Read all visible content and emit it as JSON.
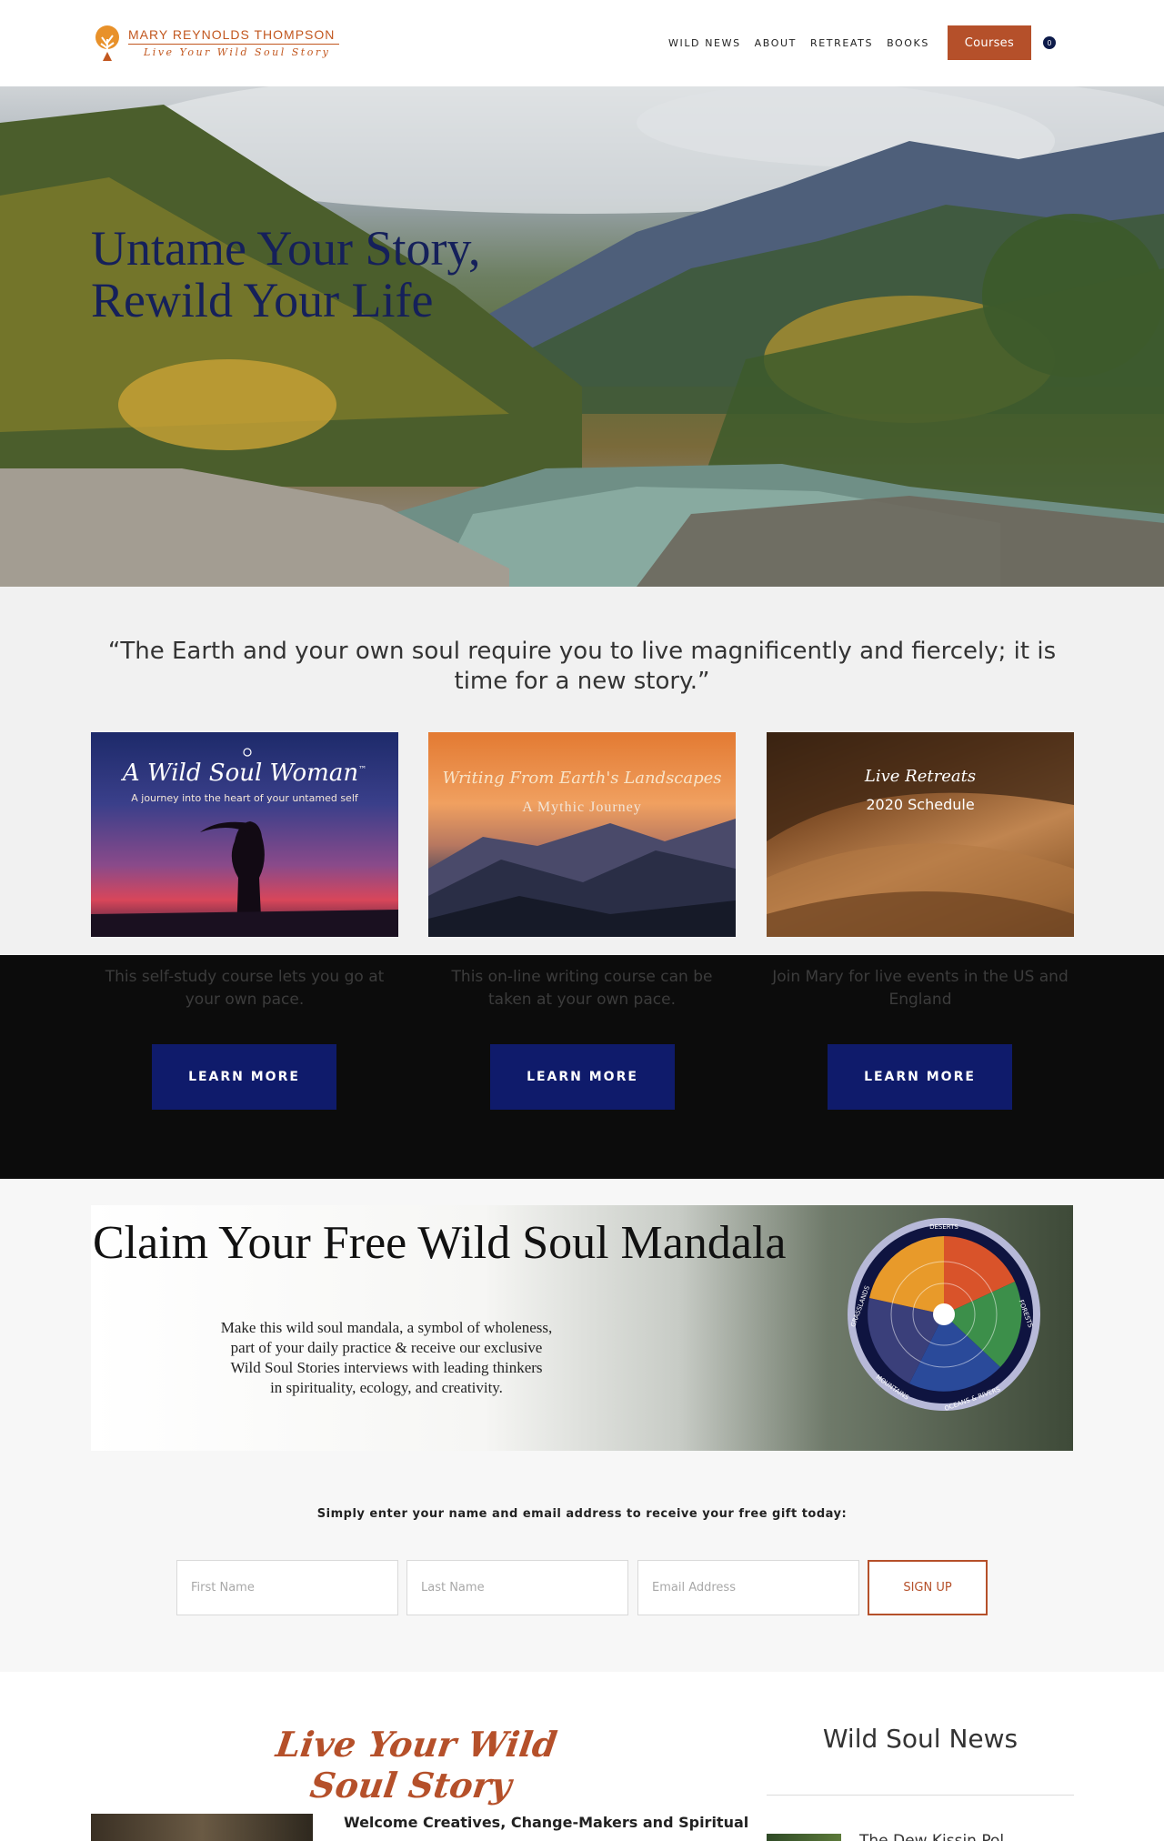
{
  "header": {
    "brand": "MARY REYNOLDS THOMPSON",
    "tagline": "Live Your Wild Soul Story",
    "nav": [
      "WILD NEWS",
      "ABOUT",
      "RETREATS",
      "BOOKS"
    ],
    "courses_label": "Courses",
    "cart_count": "0"
  },
  "hero": {
    "title_line1": "Untame Your Story,",
    "title_line2": "Rewild Your Life"
  },
  "quote": "“The Earth and your own soul require you to live magnificently and fiercely; it is time for a new story.”",
  "cards": [
    {
      "title": "A Wild Soul Woman",
      "trademark": "™",
      "subtitle": "A journey into the heart of your untamed self",
      "description": "This self-study course lets you go at your own pace.",
      "button": "LEARN MORE"
    },
    {
      "title": "Writing From Earth's Landscapes",
      "subtitle": "A Mythic Journey",
      "description": "This on-line writing course can be taken at your own pace.",
      "button": "LEARN MORE"
    },
    {
      "title": "Live Retreats",
      "subtitle": "2020 Schedule",
      "description": "Join Mary for live events in the US and England",
      "button": "LEARN MORE"
    }
  ],
  "mandala": {
    "title": "Claim Your Free Wild Soul Mandala",
    "text_line1": "Make this wild soul mandala, a symbol of wholeness,",
    "text_line2": "part of your daily practice & receive our exclusive",
    "text_line3": "Wild Soul Stories interviews with leading thinkers",
    "text_line4": "in spirituality, ecology, and creativity.",
    "wheel_labels": [
      "DESERTS",
      "FORESTS",
      "OCEANS & RIVERS",
      "MOUNTAINS",
      "GRASSLANDS"
    ]
  },
  "signup": {
    "note": "Simply enter your name and email address to receive your free gift today:",
    "first_name_placeholder": "First Name",
    "last_name_placeholder": "Last Name",
    "email_placeholder": "Email Address",
    "button": "SIGN UP"
  },
  "bottom": {
    "script_title": "Live Your Wild Soul Story",
    "news_title": "Wild Soul News",
    "post_title": "Welcome Creatives, Change-Makers and Spiritual",
    "news_item": "The Dew Kissin Pol..."
  },
  "colors": {
    "accent": "#b5502a",
    "navy": "#0f1b6b",
    "hero_text": "#15205a"
  }
}
